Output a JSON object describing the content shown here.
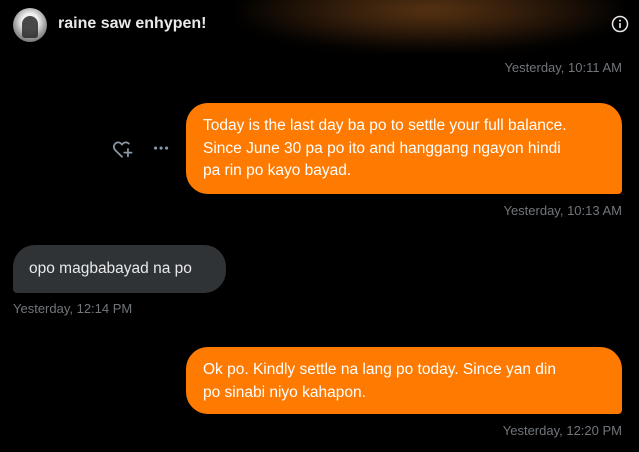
{
  "header": {
    "contact_name": "raine saw enhypen!",
    "avatar_icon": "avatar-photo",
    "info_icon": "info-circle-icon"
  },
  "messages": [
    {
      "direction": "outgoing",
      "text": "Today is the last day ba po to settle your full balance.\nSince June 30 pa po ito and hanggang ngayon hindi\npa rin po kayo bayad.",
      "timestamp": "Yesterday, 10:13 AM"
    },
    {
      "direction": "incoming",
      "text": "opo magbabayad na po",
      "timestamp": "Yesterday, 12:14 PM"
    },
    {
      "direction": "outgoing",
      "text": "Ok po. Kindly settle na lang po today. Since yan din\npo sinabi niyo kahapon.",
      "timestamp": "Yesterday, 12:20 PM"
    }
  ],
  "previous_timestamp": "Yesterday, 10:11 AM",
  "message_actions": {
    "react_icon": "heart-plus-icon",
    "more_icon": "more-dots-icon"
  },
  "colors": {
    "background": "#000000",
    "outgoing_bubble": "#ff7a00",
    "incoming_bubble": "#2f3336",
    "timestamp": "#71767b",
    "text": "#e7e9ea"
  }
}
